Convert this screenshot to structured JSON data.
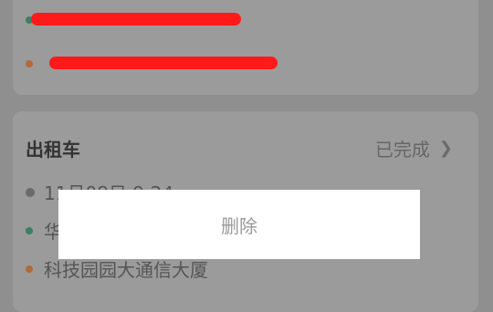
{
  "domain_hint": "Computer-Use",
  "previous_trip": {
    "start_address": "",
    "end_address": "",
    "note": "Addresses are obscured by red scribbles in the screenshot"
  },
  "trip": {
    "type": "出租车",
    "status": "已完成",
    "datetime": "11月08日 9:24",
    "start_address": "华",
    "end_address": "科技园园大通信大厦"
  },
  "dialog": {
    "delete_label": "删除"
  },
  "colors": {
    "overlay_bg": "#8f8f8f",
    "card_bg": "#9b9b9b",
    "start_dot": "#3e7f64",
    "end_dot": "#b06a3d",
    "redaction": "#ff1a1a",
    "menu_bg": "#ffffff"
  },
  "icons": {
    "chevron": "chevron-right-icon",
    "time": "clock-dot-icon"
  }
}
